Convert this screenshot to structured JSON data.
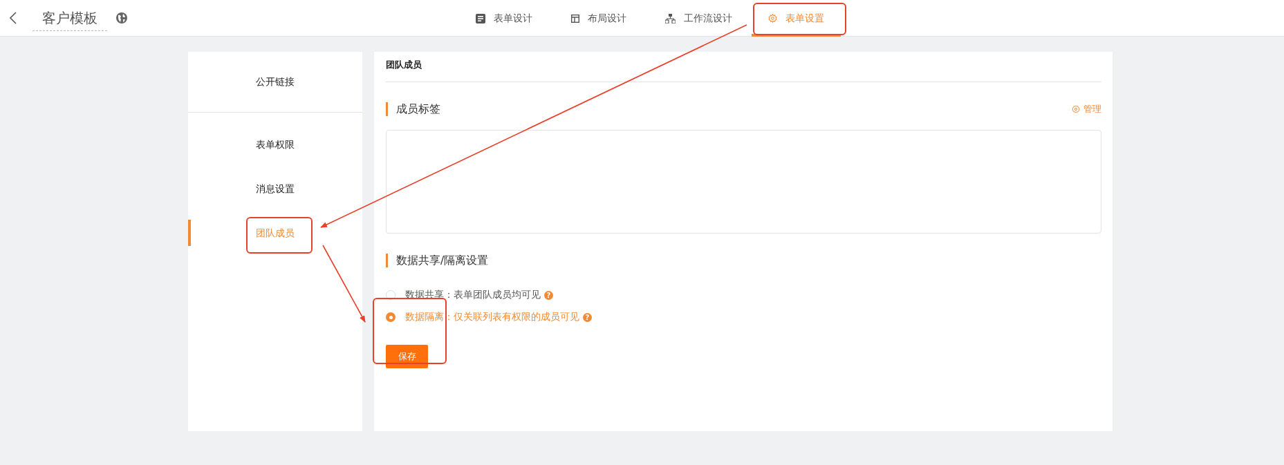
{
  "header": {
    "title": "客户模板"
  },
  "tabs": [
    {
      "label": "表单设计",
      "kind": "form",
      "selected": false
    },
    {
      "label": "布局设计",
      "kind": "layout",
      "selected": false
    },
    {
      "label": "工作流设计",
      "kind": "workflow",
      "selected": false
    },
    {
      "label": "表单设置",
      "kind": "settings",
      "selected": true
    }
  ],
  "sidebar": {
    "groups": [
      [
        {
          "label": "公开链接",
          "selected": false
        }
      ],
      [
        {
          "label": "表单权限",
          "selected": false
        },
        {
          "label": "消息设置",
          "selected": false
        },
        {
          "label": "团队成员",
          "selected": true
        }
      ]
    ]
  },
  "panel": {
    "title": "团队成员",
    "sections": [
      {
        "kind": "tags",
        "title": "成员标签",
        "action": "管理"
      },
      {
        "kind": "radios",
        "title": "数据共享/隔离设置",
        "options": [
          {
            "label": "数据共享：表单团队成员均可见",
            "help": "?",
            "selected": false
          },
          {
            "label": "数据隔离：仅关联列表有权限的成员可见",
            "help": "?",
            "selected": true
          }
        ]
      }
    ],
    "save_button": "保存"
  }
}
